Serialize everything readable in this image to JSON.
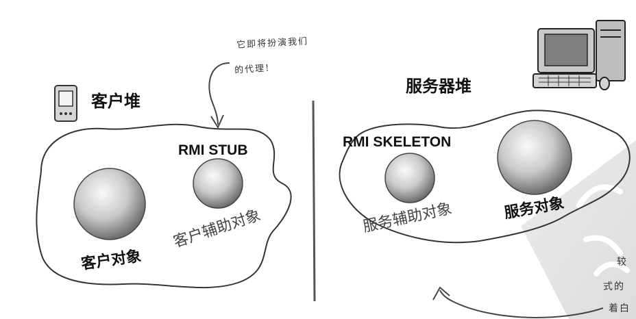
{
  "annotation_top": {
    "line1": "它即将扮演我们",
    "line2": "的代理!"
  },
  "client": {
    "heap_title": "客户堆",
    "stub_label": "RMI STUB",
    "client_object_label": "客户对象",
    "helper_label": "客户辅助对象"
  },
  "server": {
    "heap_title": "服务器堆",
    "skeleton_label": "RMI SKELETON",
    "helper_label": "服务辅助对象",
    "service_object_label": "服务对象"
  },
  "annotation_bottom_right": {
    "line1": "较",
    "line2": "式的",
    "line3": "着白"
  }
}
